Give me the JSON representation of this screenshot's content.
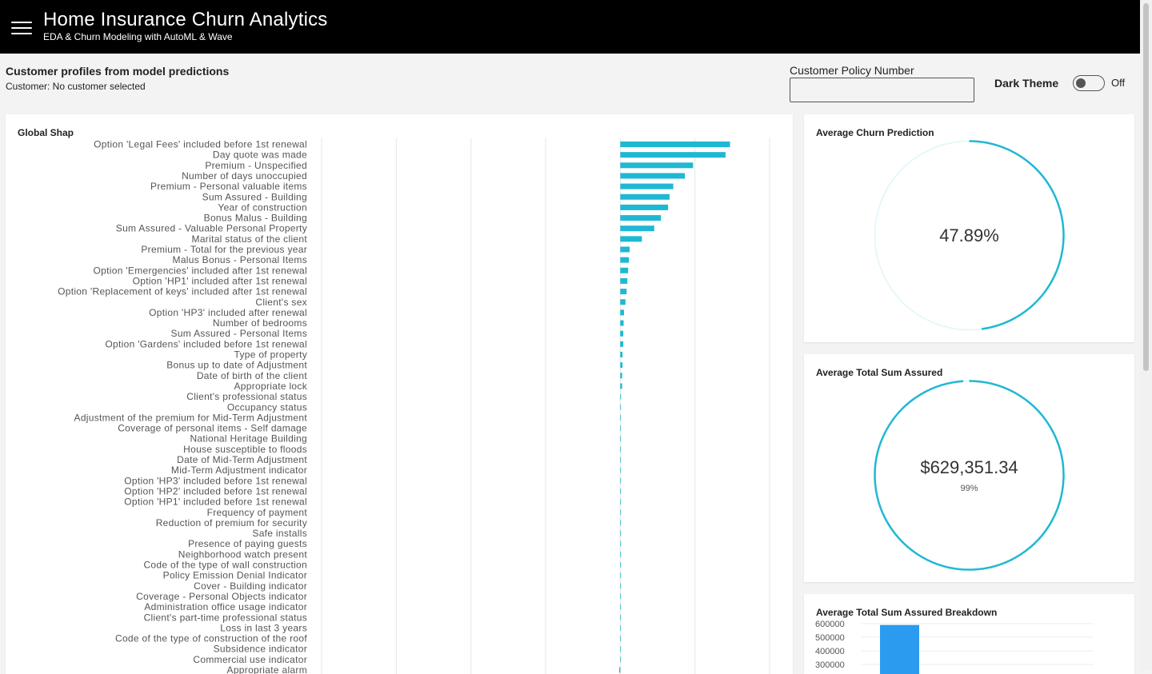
{
  "header": {
    "title": "Home Insurance Churn Analytics",
    "subtitle": "EDA & Churn Modeling with AutoML & Wave"
  },
  "profile": {
    "title": "Customer profiles from model predictions",
    "subtitle": "Customer: No customer selected"
  },
  "policy": {
    "label": "Customer Policy Number",
    "value": ""
  },
  "theme": {
    "label": "Dark Theme",
    "state": "Off",
    "on": false
  },
  "colors": {
    "accent": "#1fb8d3",
    "gauge_track": "#dff5f9",
    "breakdown_bar": "#2b9bf0",
    "header_bg": "#000000"
  },
  "icons": [
    "hamburger-menu-icon"
  ],
  "shap": {
    "title": "Global Shap",
    "chart_data": {
      "type": "bar",
      "orientation": "horizontal",
      "grid": true,
      "categories": [
        "Option 'Legal Fees' included before 1st renewal",
        "Day quote was made",
        "Premium - Unspecified",
        "Number of days unoccupied",
        "Premium - Personal valuable items",
        "Sum Assured - Building",
        "Year of construction",
        "Bonus Malus - Building",
        "Sum Assured - Valuable Personal Property",
        "Marital status of the client",
        "Premium - Total for the previous year",
        "Malus Bonus - Personal Items",
        "Option 'Emergencies' included after 1st renewal",
        "Option 'HP1' included after 1st renewal",
        "Option 'Replacement of keys' included after 1st renewal",
        "Client's sex",
        "Option 'HP3' included after renewal",
        "Number of bedrooms",
        "Sum Assured - Personal Items",
        "Option 'Gardens' included before 1st renewal",
        "Type of property",
        "Bonus up to date of Adjustment",
        "Date of birth of the client",
        "Appropriate lock",
        "Client's professional status",
        "Occupancy status",
        "Adjustment of the premium for Mid-Term Adjustment",
        "Coverage of personal items - Self damage",
        "National Heritage Building",
        "House susceptible to floods",
        "Date of Mid-Term Adjustment",
        "Mid-Term Adjustment indicator",
        "Option 'HP3' included before 1st renewal",
        "Option 'HP2' included before 1st renewal",
        "Option 'HP1' included before 1st renewal",
        "Frequency of payment",
        "Reduction of premium for security",
        "Safe installs",
        "Presence of paying guests",
        "Neighborhood watch present",
        "Code of the type of wall construction",
        "Policy Emission Denial Indicator",
        "Cover - Building indicator",
        "Coverage - Personal Objects indicator",
        "Administration office usage indicator",
        "Client's part-time professional status",
        "Loss in last 3 years",
        "Code of the type of construction of the roof",
        "Subsidence indicator",
        "Commercial use indicator",
        "Appropriate alarm"
      ],
      "values": [
        0.294,
        0.282,
        0.195,
        0.173,
        0.142,
        0.132,
        0.128,
        0.109,
        0.091,
        0.058,
        0.025,
        0.023,
        0.021,
        0.019,
        0.017,
        0.014,
        0.01,
        0.009,
        0.008,
        0.008,
        0.006,
        0.006,
        0.005,
        0.005,
        0.002,
        0.001,
        0.001,
        0.001,
        0.0,
        0.0,
        0.0,
        0.0,
        0.0,
        0.0,
        0.0,
        0.0,
        0.0,
        0.0,
        0.0,
        0.0,
        0.0,
        0.0,
        0.0,
        0.0,
        0.0,
        0.0,
        0.0,
        0.0,
        0.0,
        0.0,
        -0.003
      ],
      "xlim": [
        -0.8,
        0.4
      ]
    }
  },
  "churn_gauge": {
    "title": "Average Churn Prediction",
    "value_text": "47.89%",
    "aux_text": "",
    "fraction": 0.4789
  },
  "sum_gauge": {
    "title": "Average Total Sum Assured",
    "value_text": "$629,351.34",
    "aux_text": "99%",
    "fraction": 0.99
  },
  "breakdown": {
    "title": "Average Total Sum Assured Breakdown",
    "chart_data": {
      "type": "bar",
      "categories": [
        ""
      ],
      "values": [
        590000
      ],
      "y_ticks": [
        600000,
        500000,
        400000,
        300000
      ],
      "ylim": [
        0,
        620000
      ]
    }
  }
}
